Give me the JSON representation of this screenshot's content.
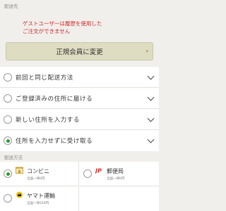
{
  "destination_section": {
    "label": "配送先"
  },
  "notice": {
    "line1": "ゲストユーザーは履歴を使用した",
    "line2": "ご注文ができません"
  },
  "upgrade_button": {
    "label": "正規会員に変更"
  },
  "address_options": [
    {
      "label": "前回と同じ配送方法",
      "selected": false
    },
    {
      "label": "ご登録済みの住所に届ける",
      "selected": false
    },
    {
      "label": "新しい住所を入力する",
      "selected": false
    },
    {
      "label": "住所を入力せずに受け取る",
      "selected": true
    }
  ],
  "method_section": {
    "label": "配送方法"
  },
  "shipping_methods": [
    {
      "name": "コンビニ",
      "price": "全国一律0円",
      "icon": "convenience-store-icon",
      "selected": true
    },
    {
      "name": "郵便局",
      "price": "全国一律0円",
      "icon": "japan-post-icon",
      "selected": false
    },
    {
      "name": "ヤマト運輸",
      "price": "全国一律250円",
      "icon": "yamato-cat-icon",
      "selected": false
    }
  ],
  "colors": {
    "notice_red": "#d42a2a",
    "selected_green": "#2a9d2a",
    "upgrade_bg": "#dedcc1",
    "page_bg": "#f1efec"
  }
}
